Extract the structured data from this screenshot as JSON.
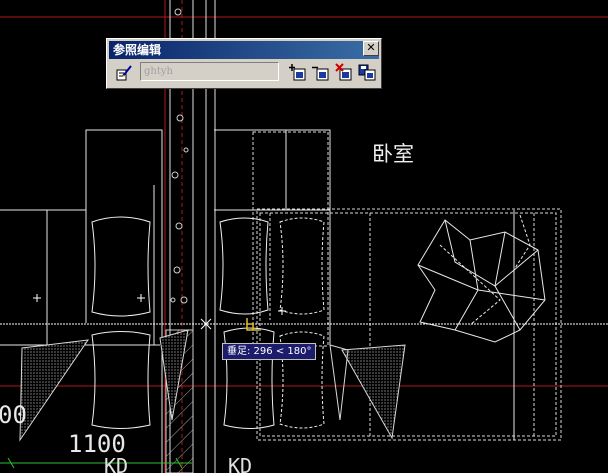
{
  "panel": {
    "title": "参照编辑",
    "close_glyph": "✕",
    "reference_name": "ghtyh",
    "buttons": [
      "add-to-workset-icon",
      "remove-from-workset-icon",
      "discard-changes-icon",
      "save-changes-icon"
    ]
  },
  "drawing": {
    "room_label": "卧室",
    "dimension_value": "1100",
    "dimension_left_partial": "00",
    "block_label_1": "KD",
    "block_label_2": "KD"
  },
  "tooltip": {
    "text": "垂足: 296 < 180°"
  },
  "colors": {
    "background": "#000000",
    "geometry": "#ffffff",
    "grid_red": "#cc2222",
    "dimension_green": "#2fbf2f",
    "title_bar": "#0a246a"
  }
}
